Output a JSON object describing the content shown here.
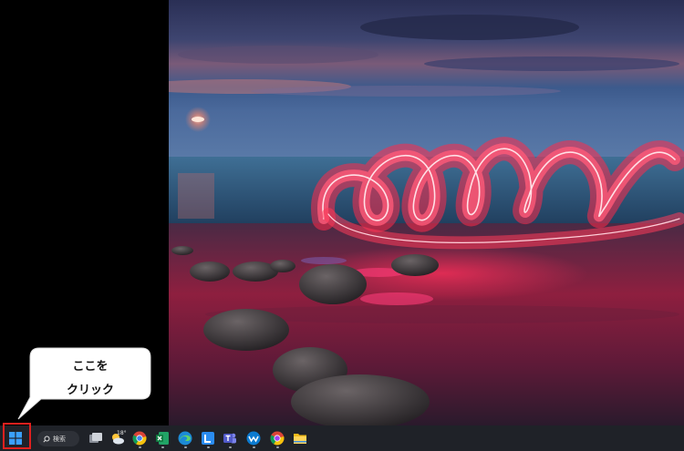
{
  "callout": {
    "line1": "ここを",
    "line2": "クリック"
  },
  "taskbar": {
    "search_label": "検索",
    "weather_temp": "18°",
    "items": [
      {
        "name": "start",
        "icon": "windows-logo-icon"
      },
      {
        "name": "search",
        "icon": "search-icon"
      },
      {
        "name": "task-view",
        "icon": "task-view-icon"
      },
      {
        "name": "weather",
        "icon": "weather-icon"
      },
      {
        "name": "chrome",
        "icon": "chrome-icon"
      },
      {
        "name": "excel",
        "icon": "excel-icon"
      },
      {
        "name": "edge",
        "icon": "edge-icon"
      },
      {
        "name": "line",
        "icon": "line-icon"
      },
      {
        "name": "teams",
        "icon": "teams-icon"
      },
      {
        "name": "webex",
        "icon": "webex-icon"
      },
      {
        "name": "chrome-profile",
        "icon": "chrome-icon"
      },
      {
        "name": "file-explorer",
        "icon": "folder-icon"
      }
    ]
  },
  "colors": {
    "highlight": "#e0201e",
    "taskbar": "#1f2228",
    "accent": "#0078d4"
  }
}
